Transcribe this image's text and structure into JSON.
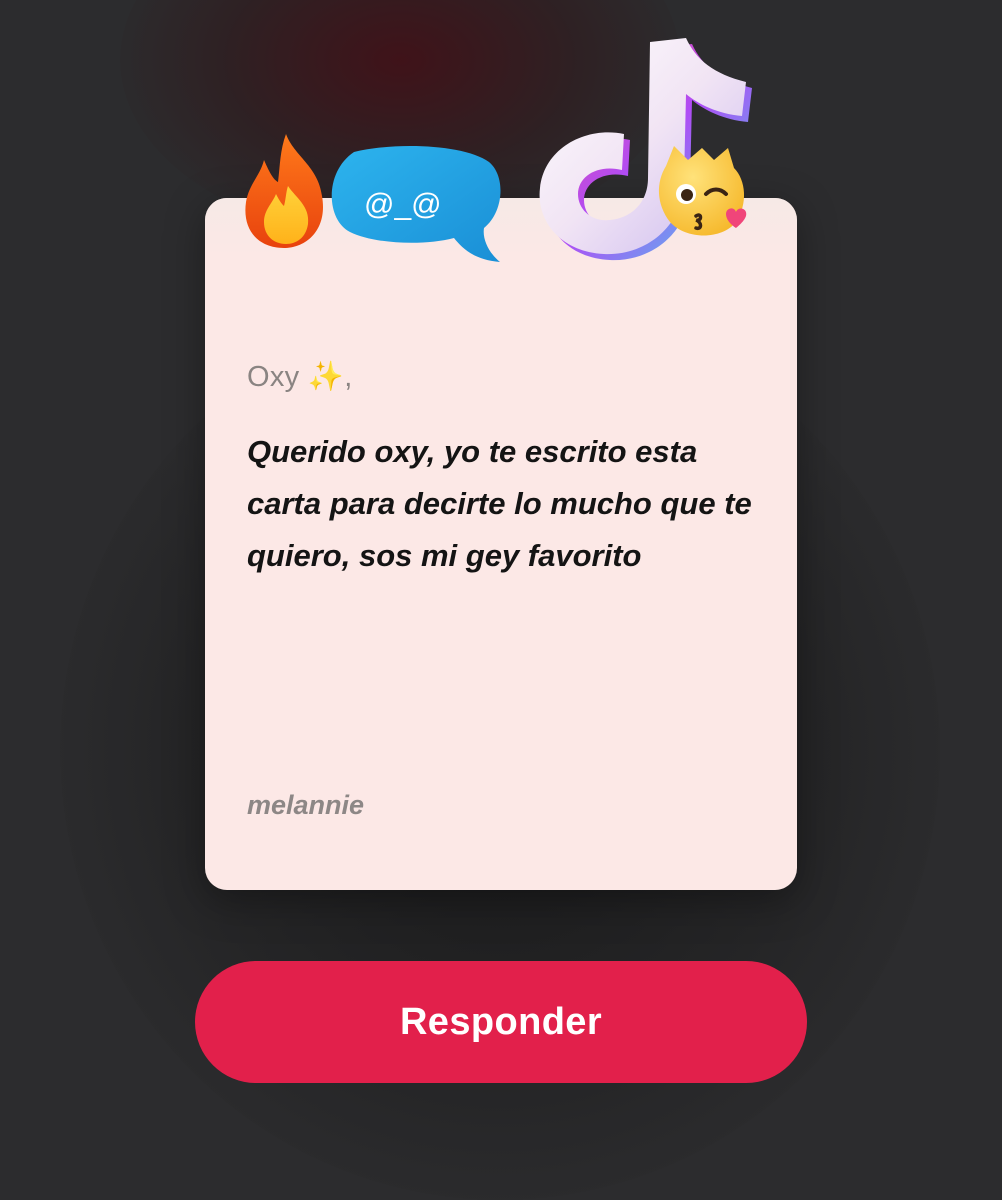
{
  "card": {
    "greeting": "Oxy ✨,",
    "message": "Querido oxy, yo te escrito esta carta para decirte lo mucho que te quiero, sos mi gey favorito",
    "signature": "melannie",
    "background_color": "#fce8e6"
  },
  "stickers": {
    "bubble_text": "@_@",
    "icons": [
      "fire-icon",
      "speech-bubble-icon",
      "music-note-icon",
      "kiss-face-icon"
    ]
  },
  "actions": {
    "respond_label": "Responder",
    "respond_color": "#e2204b"
  },
  "theme": {
    "page_background": "#2c2c2e"
  }
}
